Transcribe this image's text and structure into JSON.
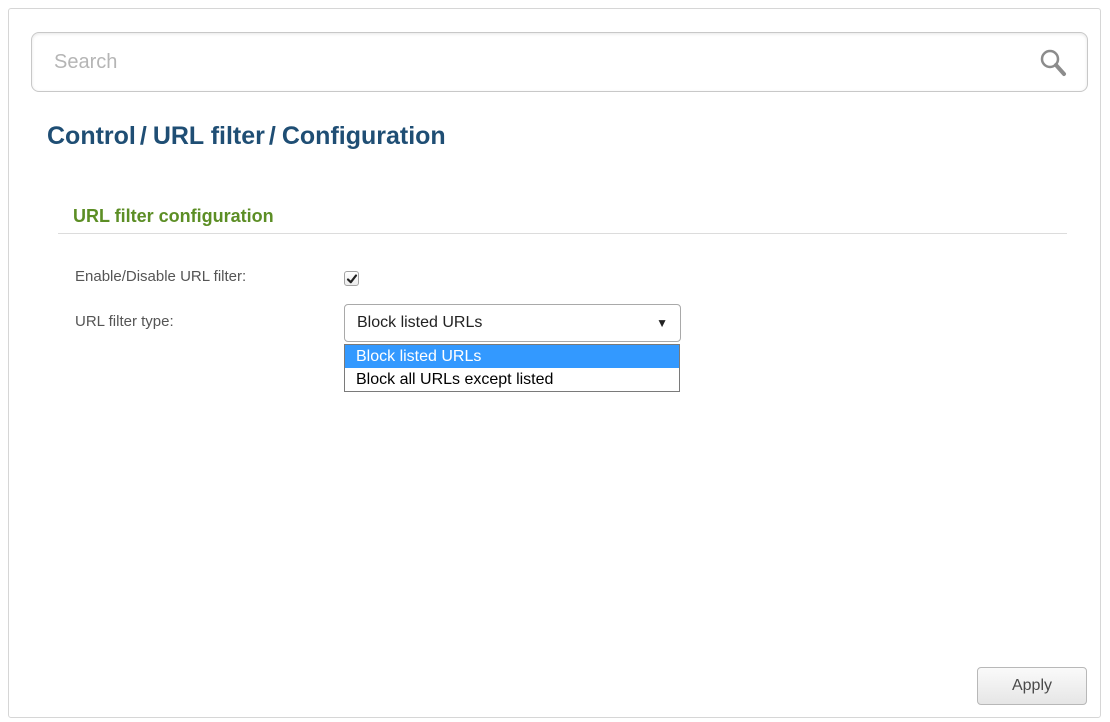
{
  "search": {
    "placeholder": "Search",
    "value": ""
  },
  "breadcrumb": {
    "items": [
      "Control",
      "URL filter",
      "Configuration"
    ],
    "separator": "/"
  },
  "section": {
    "title": "URL filter configuration"
  },
  "fields": {
    "enable": {
      "label": "Enable/Disable URL filter:",
      "checked": true
    },
    "filter_type": {
      "label": "URL filter type:",
      "selected": "Block listed URLs",
      "options": [
        "Block listed URLs",
        "Block all URLs except listed"
      ],
      "highlighted_option": "Block listed URLs",
      "arrow": "▼"
    }
  },
  "actions": {
    "apply_label": "Apply"
  },
  "icons": {
    "search": "search-icon",
    "checkmark": "checkmark-icon",
    "dropdown": "chevron-down-icon"
  },
  "colors": {
    "title": "#1f4e74",
    "section_heading": "#5c8e25",
    "selected_option_bg": "#3399ff"
  }
}
